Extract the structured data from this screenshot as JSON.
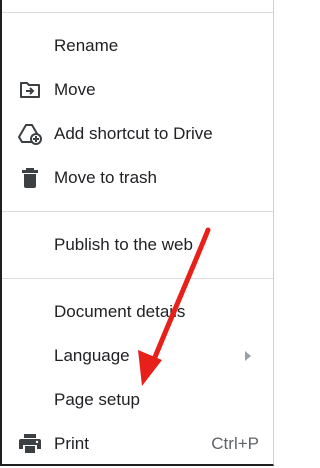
{
  "menu": {
    "items": [
      {
        "label": "Rename",
        "icon": "none"
      },
      {
        "label": "Move",
        "icon": "move-to-folder-icon"
      },
      {
        "label": "Add shortcut to Drive",
        "icon": "add-shortcut-icon"
      },
      {
        "label": "Move to trash",
        "icon": "trash-icon"
      },
      {
        "label": "Publish to the web",
        "icon": "none"
      },
      {
        "label": "Document details",
        "icon": "none"
      },
      {
        "label": "Language",
        "icon": "none",
        "submenu": true
      },
      {
        "label": "Page setup",
        "icon": "none"
      },
      {
        "label": "Print",
        "icon": "print-icon",
        "shortcut": "Ctrl+P"
      }
    ]
  },
  "annotation": {
    "arrow_color": "#e8201a"
  },
  "colors": {
    "text": "#202124",
    "icon": "#3c4043",
    "divider": "#dadce0",
    "muted": "#5f6368"
  }
}
